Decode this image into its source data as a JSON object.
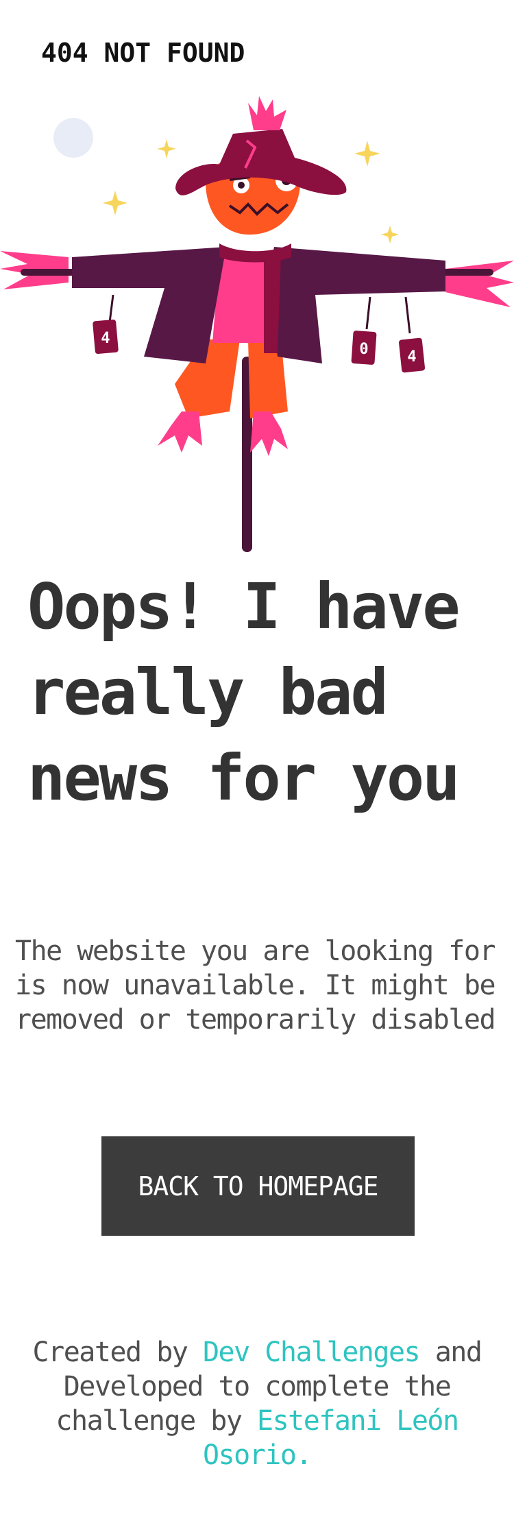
{
  "header": {
    "title": "404 NOT FOUND"
  },
  "illustration": {
    "can_left": "4",
    "can_mid": "0",
    "can_right": "4",
    "icon": "scarecrow-illustration"
  },
  "main": {
    "headline": "Oops! I have really bad news for you",
    "message": "The website you are looking for is now unavailable. It might be removed or temporarily disabled",
    "button_label": "BACK TO HOMEPAGE"
  },
  "footer": {
    "created_by": "Created by",
    "dev_challenges": "Dev Challenges",
    "and_developed": "and Developed to complete the challenge by",
    "author": "Estefani León Osorio."
  },
  "colors": {
    "accent": "#2ec4c0",
    "button_bg": "#3c3c3c",
    "text": "#333333",
    "hat": "#8b0f3f",
    "jacket": "#571846",
    "pumpkin": "#ff5722",
    "straw": "#ff3d8b",
    "star": "#f7d55c",
    "moon": "#e8ecf6"
  }
}
